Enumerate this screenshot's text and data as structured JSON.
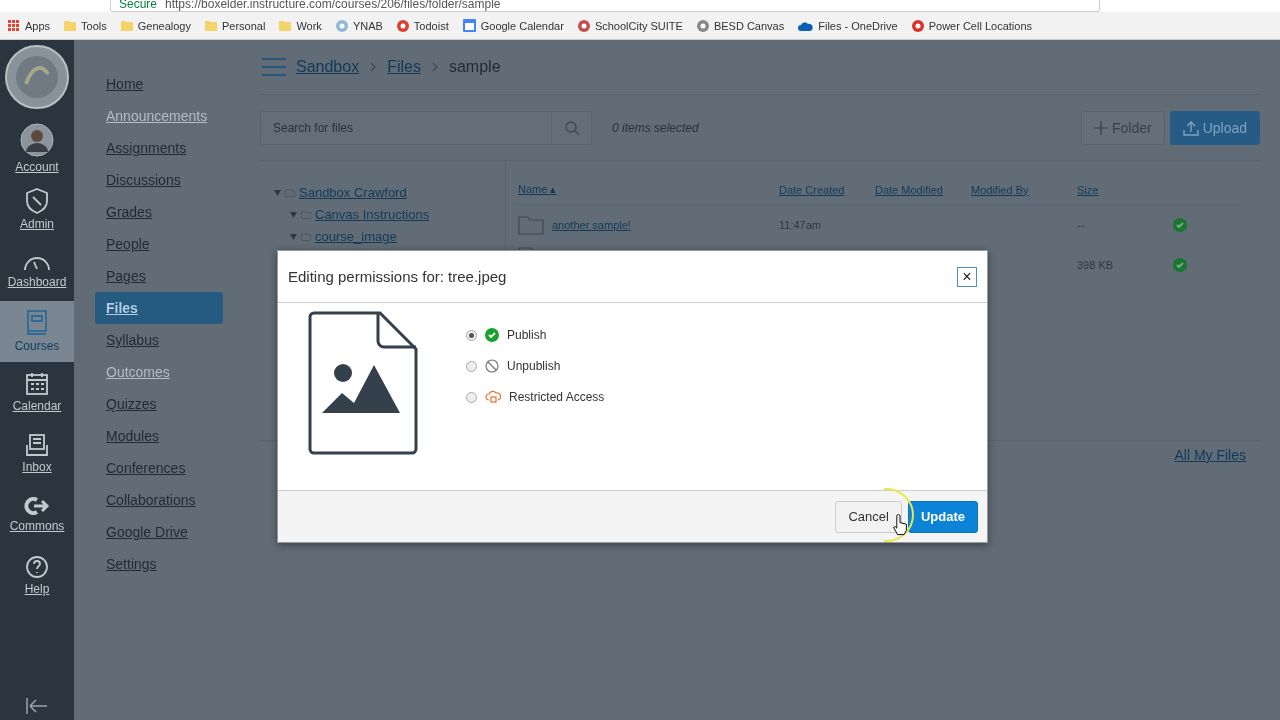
{
  "browser": {
    "secure_label": "Secure",
    "url": "https://boxelder.instructure.com/courses/206/files/folder/sample",
    "bookmarks": [
      {
        "label": "Apps",
        "kind": "apps"
      },
      {
        "label": "Tools",
        "kind": "folder"
      },
      {
        "label": "Genealogy",
        "kind": "folder"
      },
      {
        "label": "Personal",
        "kind": "folder"
      },
      {
        "label": "Work",
        "kind": "folder"
      },
      {
        "label": "YNAB",
        "kind": "site",
        "color": "#8fb8d8"
      },
      {
        "label": "Todoist",
        "kind": "site",
        "color": "#db4035"
      },
      {
        "label": "Google Calendar",
        "kind": "calendar",
        "color": "#4285f4"
      },
      {
        "label": "SchoolCity SUITE",
        "kind": "site",
        "color": "#c0504d"
      },
      {
        "label": "BESD Canvas",
        "kind": "site",
        "color": "#888888"
      },
      {
        "label": "Files - OneDrive",
        "kind": "cloud",
        "color": "#0a5fb4"
      },
      {
        "label": "Power Cell Locations",
        "kind": "site",
        "color": "#d9322b"
      }
    ]
  },
  "global_nav": [
    {
      "label": "Account",
      "kind": "avatar",
      "selected": false
    },
    {
      "label": "Admin",
      "kind": "admin",
      "selected": false
    },
    {
      "label": "Dashboard",
      "kind": "dashboard",
      "selected": false
    },
    {
      "label": "Courses",
      "kind": "courses",
      "selected": true
    },
    {
      "label": "Calendar",
      "kind": "calendar",
      "selected": false
    },
    {
      "label": "Inbox",
      "kind": "inbox",
      "selected": false
    },
    {
      "label": "Commons",
      "kind": "commons",
      "selected": false
    },
    {
      "label": "Help",
      "kind": "help",
      "selected": false
    }
  ],
  "course_nav": [
    {
      "label": "Home",
      "selected": false,
      "disabled": false
    },
    {
      "label": "Announcements",
      "selected": false,
      "disabled": true
    },
    {
      "label": "Assignments",
      "selected": false,
      "disabled": false
    },
    {
      "label": "Discussions",
      "selected": false,
      "disabled": false
    },
    {
      "label": "Grades",
      "selected": false,
      "disabled": false
    },
    {
      "label": "People",
      "selected": false,
      "disabled": false
    },
    {
      "label": "Pages",
      "selected": false,
      "disabled": false
    },
    {
      "label": "Files",
      "selected": true,
      "disabled": false
    },
    {
      "label": "Syllabus",
      "selected": false,
      "disabled": false
    },
    {
      "label": "Outcomes",
      "selected": false,
      "disabled": true
    },
    {
      "label": "Quizzes",
      "selected": false,
      "disabled": false
    },
    {
      "label": "Modules",
      "selected": false,
      "disabled": false
    },
    {
      "label": "Conferences",
      "selected": false,
      "disabled": false
    },
    {
      "label": "Collaborations",
      "selected": false,
      "disabled": false
    },
    {
      "label": "Google Drive",
      "selected": false,
      "disabled": false
    },
    {
      "label": "Settings",
      "selected": false,
      "disabled": false
    }
  ],
  "breadcrumbs": [
    "Sandbox",
    "Files",
    "sample"
  ],
  "search": {
    "placeholder": "Search for files"
  },
  "selection_count": "0 items selected",
  "buttons": {
    "folder": "Folder",
    "upload": "Upload"
  },
  "folder_tree": [
    {
      "label": "Sandbox Crawford",
      "children": [
        {
          "label": "Canvas Instructions"
        },
        {
          "label": "course_image"
        }
      ]
    }
  ],
  "table": {
    "columns": [
      "Name ▴",
      "Date Created",
      "Date Modified",
      "Modified By",
      "Size"
    ],
    "rows": [
      {
        "name": "another sample!",
        "kind": "folder",
        "date_created": "11:47am",
        "size": "--",
        "published": true
      },
      {
        "name": "",
        "kind": "file",
        "date_created": "",
        "size": "398 KB",
        "published": true
      }
    ]
  },
  "all_files_link": "All My Files",
  "dialog": {
    "title": "Editing permissions for: tree.jpeg",
    "close": "×",
    "options": [
      {
        "label": "Publish",
        "kind": "publish",
        "selected": true
      },
      {
        "label": "Unpublish",
        "kind": "unpublish",
        "selected": false
      },
      {
        "label": "Restricted Access",
        "kind": "restricted",
        "selected": false
      }
    ],
    "cancel": "Cancel",
    "update": "Update"
  }
}
